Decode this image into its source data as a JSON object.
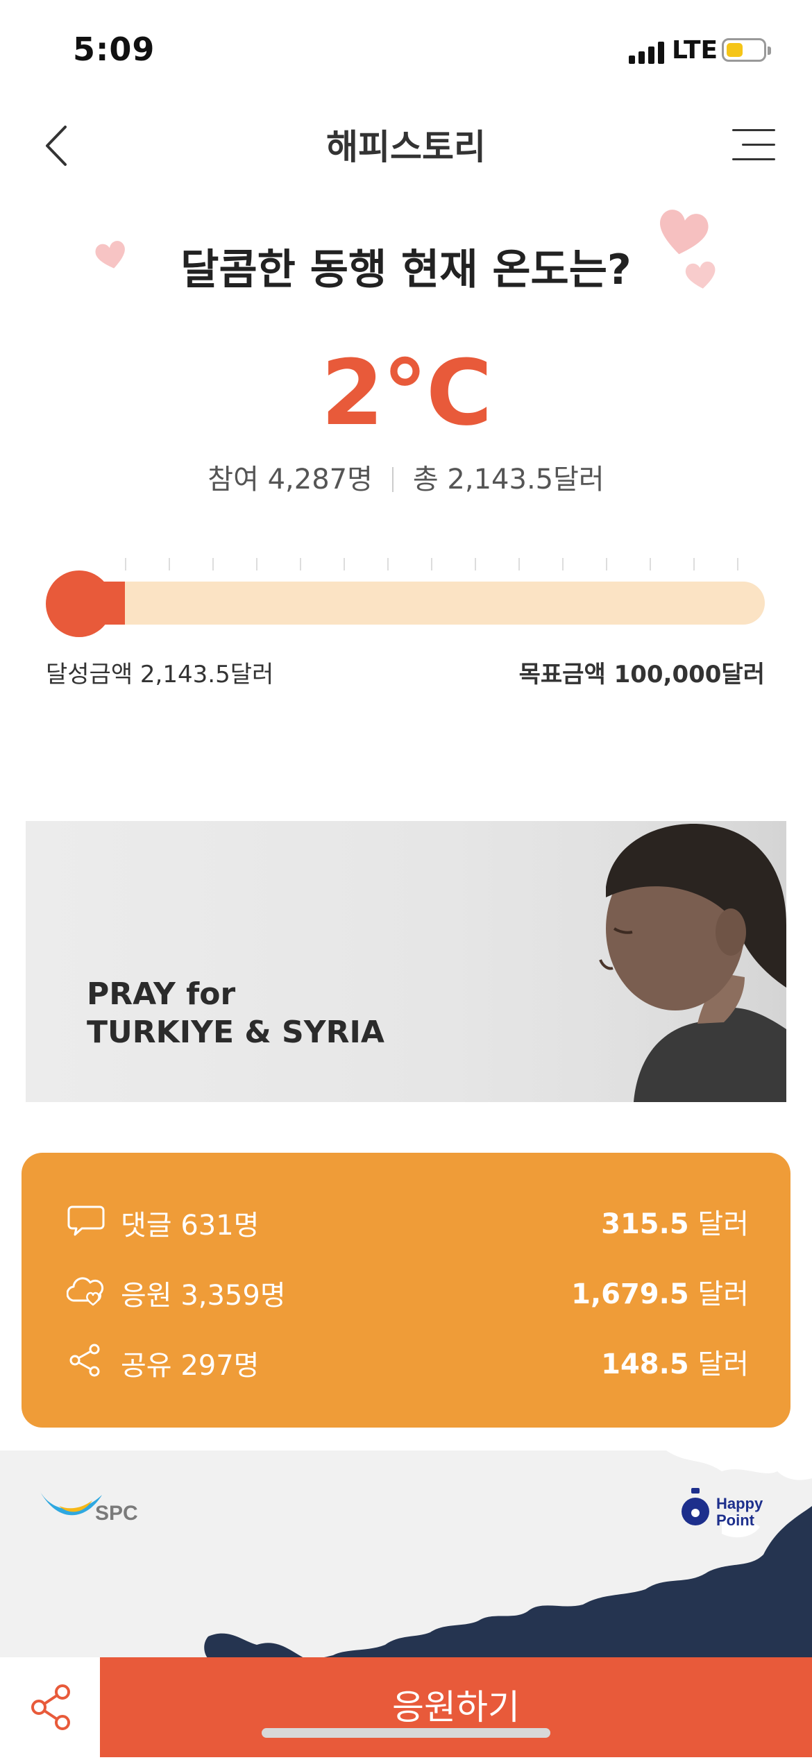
{
  "status_bar": {
    "time": "5:09",
    "network": "LTE",
    "battery_level": 0.45
  },
  "nav": {
    "title": "해피스토리",
    "back_icon": "chevron-left-icon",
    "menu_icon": "menu-icon"
  },
  "hero": {
    "headline": "달콤한 동행 현재 온도는?",
    "temperature": "2°C",
    "participants": "참여 4,287명",
    "total": "총 2,143.5달러"
  },
  "progress": {
    "achieved_label": "달성금액 2,143.5달러",
    "goal_label": "목표금액 100,000달러",
    "fraction": 0.021
  },
  "banner": {
    "line1": "PRAY for",
    "line2": "TURKIYE & SYRIA"
  },
  "breakdown": {
    "comments": {
      "label": "댓글 631명",
      "value": "315.5",
      "unit": "달러",
      "icon": "comment-icon"
    },
    "cheers": {
      "label": "응원 3,359명",
      "value": "1,679.5",
      "unit": "달러",
      "icon": "heart-cloud-icon"
    },
    "shares": {
      "label": "공유 297명",
      "value": "148.5",
      "unit": "달러",
      "icon": "share-icon"
    }
  },
  "sponsors": {
    "left": "SPC",
    "right_line1": "Happy",
    "right_line2": "Point"
  },
  "bottom": {
    "cta_label": "응원하기",
    "share_icon": "share-icon"
  },
  "colors": {
    "accent": "#e85a3a",
    "card": "#ef9c38",
    "track": "#fbe3c4",
    "navy": "#253450"
  }
}
